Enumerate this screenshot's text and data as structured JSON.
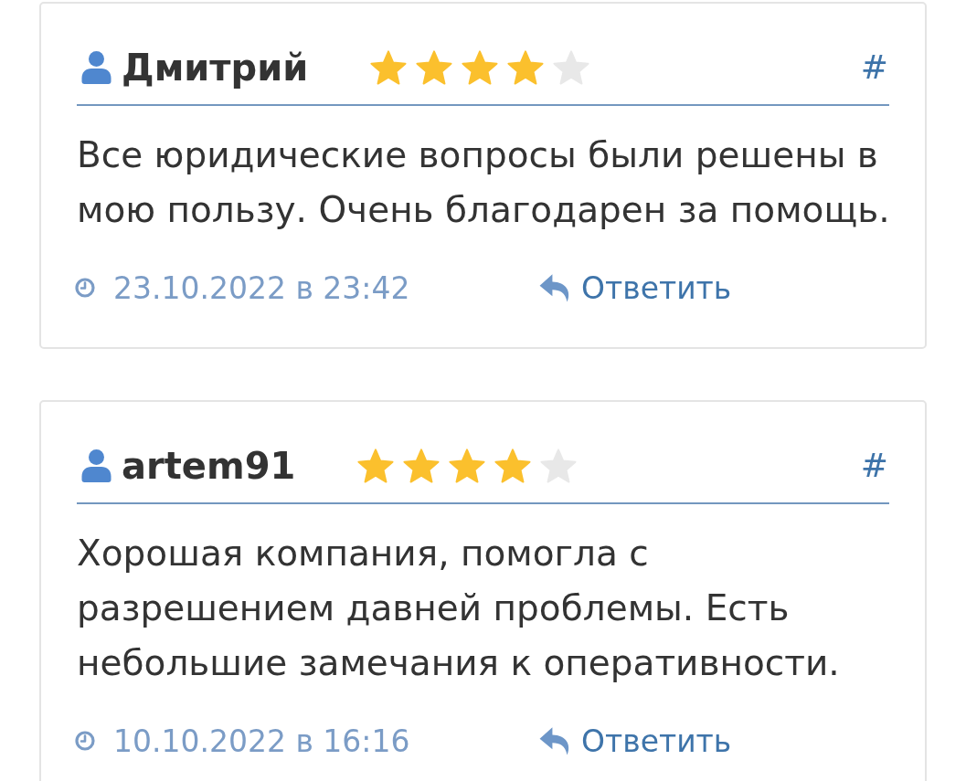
{
  "reviews": [
    {
      "author": "Дмитрий",
      "stars": 4,
      "anchor": "#",
      "text": "Все юридические вопросы были решены в мою пользу. Очень благодарен за помощь.",
      "date": "23.10.2022 в 23:42",
      "reply": "Ответить"
    },
    {
      "author": "artem91",
      "stars": 4,
      "anchor": "#",
      "text": "Хорошая компания, помогла с разрешением давней проблемы. Есть небольшие замечания к оперативности.",
      "date": "10.10.2022 в 16:16",
      "reply": "Ответить"
    }
  ]
}
